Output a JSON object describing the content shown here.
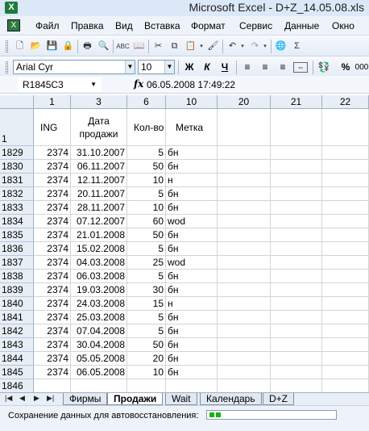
{
  "window": {
    "title": "Microsoft Excel - D+Z_14.05.08.xls",
    "app_icon": "X"
  },
  "menu": [
    "Файл",
    "Правка",
    "Вид",
    "Вставка",
    "Формат",
    "Сервис",
    "Данные",
    "Окно"
  ],
  "toolbar": {
    "font_name": "Arial Cyr",
    "font_size": "10",
    "bold": "Ж",
    "italic": "К",
    "underline": "Ч",
    "percent": "%",
    "comma": "000",
    "sigma": "Σ"
  },
  "formula_bar": {
    "name_box": "R1845C3",
    "fx": "fx",
    "value": "06.05.2008  17:49:22"
  },
  "columns": [
    "1",
    "3",
    "6",
    "10",
    "20",
    "21",
    "22"
  ],
  "header_row": {
    "row_label": "1",
    "c1": "ING",
    "c3": "Дата продажи",
    "c6": "Кол-во",
    "c10": "Метка"
  },
  "rows": [
    {
      "n": "1829",
      "ing": "2374",
      "date": "31.10.2007",
      "qty": "5",
      "mark": "бн"
    },
    {
      "n": "1830",
      "ing": "2374",
      "date": "06.11.2007",
      "qty": "50",
      "mark": "бн"
    },
    {
      "n": "1831",
      "ing": "2374",
      "date": "12.11.2007",
      "qty": "10",
      "mark": "н"
    },
    {
      "n": "1832",
      "ing": "2374",
      "date": "20.11.2007",
      "qty": "5",
      "mark": "бн"
    },
    {
      "n": "1833",
      "ing": "2374",
      "date": "28.11.2007",
      "qty": "10",
      "mark": "бн"
    },
    {
      "n": "1834",
      "ing": "2374",
      "date": "07.12.2007",
      "qty": "60",
      "mark": "wod"
    },
    {
      "n": "1835",
      "ing": "2374",
      "date": "21.01.2008",
      "qty": "50",
      "mark": "бн"
    },
    {
      "n": "1836",
      "ing": "2374",
      "date": "15.02.2008",
      "qty": "5",
      "mark": "бн"
    },
    {
      "n": "1837",
      "ing": "2374",
      "date": "04.03.2008",
      "qty": "25",
      "mark": "wod"
    },
    {
      "n": "1838",
      "ing": "2374",
      "date": "06.03.2008",
      "qty": "5",
      "mark": "бн"
    },
    {
      "n": "1839",
      "ing": "2374",
      "date": "19.03.2008",
      "qty": "30",
      "mark": "бн"
    },
    {
      "n": "1840",
      "ing": "2374",
      "date": "24.03.2008",
      "qty": "15",
      "mark": "н"
    },
    {
      "n": "1841",
      "ing": "2374",
      "date": "25.03.2008",
      "qty": "5",
      "mark": "бн"
    },
    {
      "n": "1842",
      "ing": "2374",
      "date": "07.04.2008",
      "qty": "5",
      "mark": "бн"
    },
    {
      "n": "1843",
      "ing": "2374",
      "date": "30.04.2008",
      "qty": "50",
      "mark": "бн"
    },
    {
      "n": "1844",
      "ing": "2374",
      "date": "05.05.2008",
      "qty": "20",
      "mark": "бн"
    },
    {
      "n": "1845",
      "ing": "2374",
      "date": "06.05.2008",
      "qty": "10",
      "mark": "бн"
    },
    {
      "n": "1846",
      "ing": "",
      "date": "",
      "qty": "",
      "mark": ""
    }
  ],
  "sheets": [
    "Фирмы",
    "Продажи",
    "Wait",
    "Календарь",
    "D+Z"
  ],
  "active_sheet": "Продажи",
  "status": {
    "text": "Сохранение данных для автовосстановления:",
    "progress_fraction": 0.1
  }
}
